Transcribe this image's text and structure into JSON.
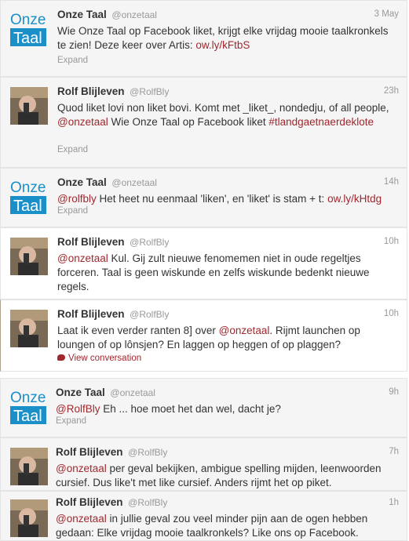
{
  "tweets": [
    {
      "author": "Onze Taal",
      "handle": "@onzetaal",
      "time": "3 May",
      "parts": [
        {
          "t": "Wie Onze Taal op Facebook liket, krijgt elke vrijdag mooie taalkronkels te zien! Deze keer over Artis: "
        },
        {
          "t": "ow.ly/kFtbS",
          "link": true
        }
      ],
      "footer": "Expand"
    },
    {
      "author": "Rolf Blijleven",
      "handle": "@RolfBly",
      "time": "23h",
      "parts": [
        {
          "t": "Quod liket lovi non liket bovi. Komt met _liket_, nondedju, of all people, "
        },
        {
          "t": "@onzetaal",
          "link": true
        },
        {
          "t": " Wie Onze Taal op Facebook liket "
        },
        {
          "t": "#tlandgaetnaerdeklote",
          "link": true
        }
      ],
      "footer": "Expand"
    },
    {
      "author": "Onze Taal",
      "handle": "@onzetaal",
      "time": "14h",
      "parts": [
        {
          "t": "@rolfbly",
          "link": true
        },
        {
          "t": " Het heet nu eenmaal 'liken', en 'liket' is stam + t: "
        },
        {
          "t": "ow.ly/kHtdg",
          "link": true
        }
      ],
      "footer": "Expand"
    },
    {
      "author": "Rolf Blijleven",
      "handle": "@RolfBly",
      "time": "10h",
      "parts": [
        {
          "t": "@onzetaal",
          "link": true
        },
        {
          "t": " Kul. Gij zult nieuwe fenomemen niet in oude regeltjes forceren. Taal is geen wiskunde en zelfs wiskunde bedenkt nieuwe regels."
        }
      ],
      "footer": ""
    },
    {
      "author": "Rolf Blijleven",
      "handle": "@RolfBly",
      "time": "10h",
      "parts": [
        {
          "t": "Laat ik even verder ranten 8] over "
        },
        {
          "t": "@onzetaal",
          "link": true
        },
        {
          "t": ". Rijmt launchen op loungen of op lônsjen? En laggen op heggen of op plaggen?"
        }
      ],
      "footer": "View conversation"
    },
    {
      "author": "Onze Taal",
      "handle": "@onzetaal",
      "time": "9h",
      "parts": [
        {
          "t": "@RolfBly",
          "link": true
        },
        {
          "t": " Eh ... hoe moet het dan wel, dacht je?"
        }
      ],
      "footer": "Expand"
    },
    {
      "author": "Rolf Blijleven",
      "handle": "@RolfBly",
      "time": "7h",
      "parts": [
        {
          "t": "@onzetaal",
          "link": true
        },
        {
          "t": " per geval bekijken, ambigue spelling mijden, leenwoorden cursief. Dus like't met like cursief. Anders rijmt het op piket."
        }
      ],
      "footer": ""
    },
    {
      "author": "Rolf Blijleven",
      "handle": "@RolfBly",
      "time": "1h",
      "parts": [
        {
          "t": "@onzetaal",
          "link": true
        },
        {
          "t": " in jullie geval zou veel minder pijn aan de ogen hebben gedaan: Elke vrijdag mooie taalkronkels? Like ons op Facebook."
        }
      ],
      "footer": ""
    }
  ],
  "logo": {
    "line1": "Onze",
    "line2": "Taal",
    "blue": "#1a8fc8"
  },
  "colors": {
    "link": "#a0282e",
    "shaded": "#f5f5f5"
  }
}
